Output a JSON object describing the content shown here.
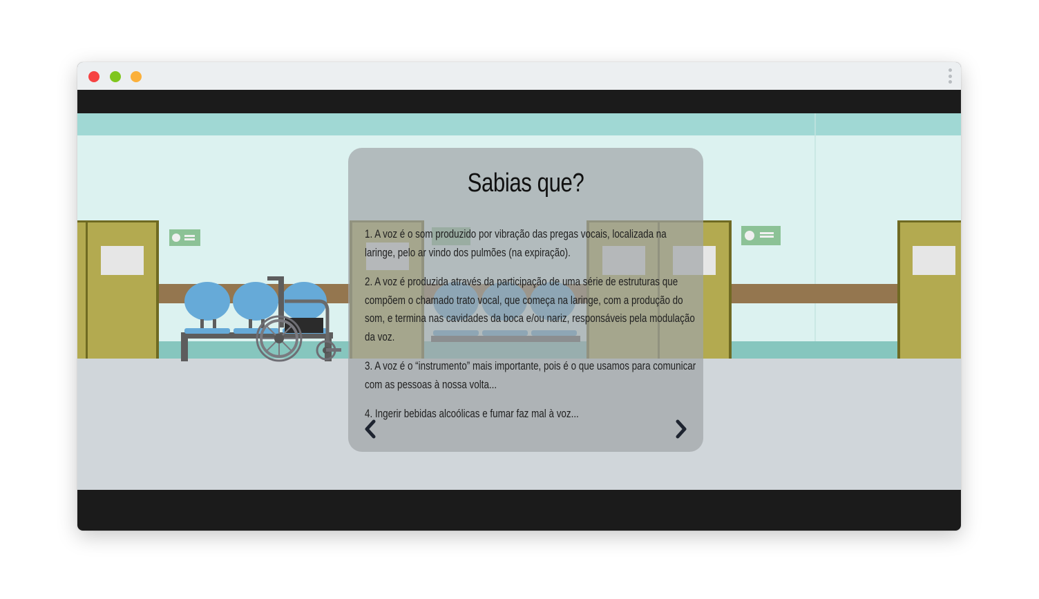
{
  "window": {
    "controls": [
      "close",
      "minimize",
      "maximize"
    ],
    "menu_icon": "kebab-menu-icon"
  },
  "scene": {
    "description_icons": [
      "wheelchair-icon",
      "waiting-chairs",
      "door",
      "exit-sign"
    ]
  },
  "modal": {
    "title": "Sabias que?",
    "facts": [
      "1. A voz é o som produzido por vibração das pregas vocais, localizada na laringe, pelo ar vindo dos pulmões (na expiração).",
      "2. A voz é produzida através da participação de uma série de estruturas que compõem o chamado trato vocal, que começa na laringe, com a produção do som, e termina nas cavidades da boca e/ou nariz, responsáveis pela modulação da voz.",
      "3. A voz é o “instrumento” mais importante, pois é o que usamos para comunicar com as pessoas à nossa volta...",
      "4. Ingerir bebidas alcoólicas e fumar faz mal à voz..."
    ],
    "prev_icon": "chevron-left-icon",
    "next_icon": "chevron-right-icon"
  },
  "colors": {
    "close": "#f64343",
    "minimize": "#7fc61e",
    "maximize": "#fbb03b",
    "wall": "#dcf2f0",
    "ceiling_band": "#a0d8d4",
    "floor": "#d0d6da",
    "rail": "#94764f",
    "door": "#b3aa50",
    "chair": "#66aad8"
  }
}
